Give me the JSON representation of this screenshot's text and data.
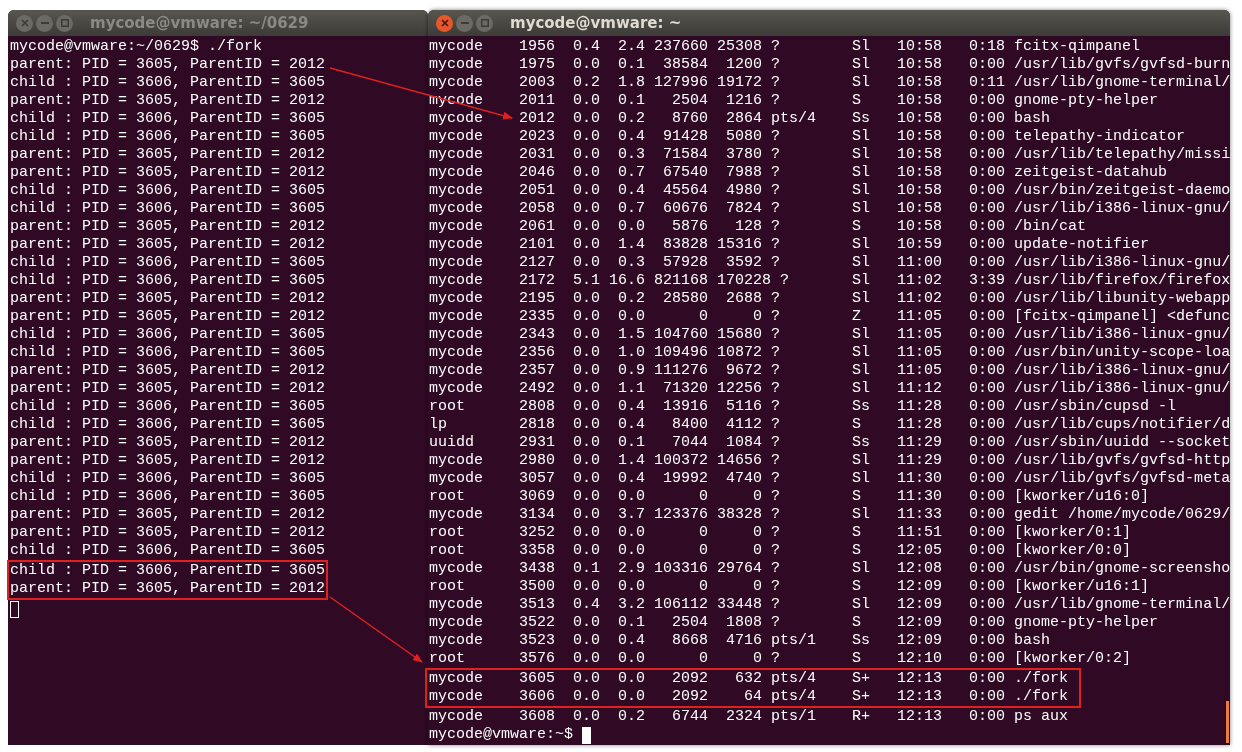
{
  "left_window": {
    "title": "mycode@vmware: ~/0629",
    "active": false,
    "prompt_line": "mycode@vmware:~/0629$ ./fork",
    "lines": [
      {
        "text": "parent: PID = 3605, ParentID = 2012",
        "highlighted": false
      },
      {
        "text": "child : PID = 3606, ParentID = 3605",
        "highlighted": false
      },
      {
        "text": "parent: PID = 3605, ParentID = 2012",
        "highlighted": false
      },
      {
        "text": "child : PID = 3606, ParentID = 3605",
        "highlighted": false
      },
      {
        "text": "child : PID = 3606, ParentID = 3605",
        "highlighted": false
      },
      {
        "text": "parent: PID = 3605, ParentID = 2012",
        "highlighted": false
      },
      {
        "text": "parent: PID = 3605, ParentID = 2012",
        "highlighted": false
      },
      {
        "text": "child : PID = 3606, ParentID = 3605",
        "highlighted": false
      },
      {
        "text": "child : PID = 3606, ParentID = 3605",
        "highlighted": false
      },
      {
        "text": "parent: PID = 3605, ParentID = 2012",
        "highlighted": false
      },
      {
        "text": "parent: PID = 3605, ParentID = 2012",
        "highlighted": false
      },
      {
        "text": "child : PID = 3606, ParentID = 3605",
        "highlighted": false
      },
      {
        "text": "child : PID = 3606, ParentID = 3605",
        "highlighted": false
      },
      {
        "text": "parent: PID = 3605, ParentID = 2012",
        "highlighted": false
      },
      {
        "text": "parent: PID = 3605, ParentID = 2012",
        "highlighted": false
      },
      {
        "text": "child : PID = 3606, ParentID = 3605",
        "highlighted": false
      },
      {
        "text": "child : PID = 3606, ParentID = 3605",
        "highlighted": false
      },
      {
        "text": "parent: PID = 3605, ParentID = 2012",
        "highlighted": false
      },
      {
        "text": "parent: PID = 3605, ParentID = 2012",
        "highlighted": false
      },
      {
        "text": "child : PID = 3606, ParentID = 3605",
        "highlighted": false
      },
      {
        "text": "child : PID = 3606, ParentID = 3605",
        "highlighted": false
      },
      {
        "text": "parent: PID = 3605, ParentID = 2012",
        "highlighted": false
      },
      {
        "text": "parent: PID = 3605, ParentID = 2012",
        "highlighted": false
      },
      {
        "text": "child : PID = 3606, ParentID = 3605",
        "highlighted": false
      },
      {
        "text": "child : PID = 3606, ParentID = 3605",
        "highlighted": false
      },
      {
        "text": "parent: PID = 3605, ParentID = 2012",
        "highlighted": false
      },
      {
        "text": "parent: PID = 3605, ParentID = 2012",
        "highlighted": false
      },
      {
        "text": "child : PID = 3606, ParentID = 3605",
        "highlighted": false
      },
      {
        "text": "child : PID = 3606, ParentID = 3605",
        "highlighted": true
      },
      {
        "text": "parent: PID = 3605, ParentID = 2012",
        "highlighted": true
      }
    ]
  },
  "right_window": {
    "title": "mycode@vmware: ~",
    "active": true,
    "prompt": "mycode@vmware:~$",
    "processes": [
      {
        "user": "mycode",
        "pid": "1956",
        "cpu": "0.4",
        "mem": "2.4",
        "vsz": "237660",
        "rss": "25308",
        "tty": "?",
        "stat": "Sl",
        "start": "10:58",
        "time": "0:18",
        "command": "fcitx-qimpanel",
        "highlighted": false
      },
      {
        "user": "mycode",
        "pid": "1975",
        "cpu": "0.0",
        "mem": "0.1",
        "vsz": "38584",
        "rss": "1200",
        "tty": "?",
        "stat": "Sl",
        "start": "10:58",
        "time": "0:00",
        "command": "/usr/lib/gvfs/gvfsd-burn",
        "highlighted": false
      },
      {
        "user": "mycode",
        "pid": "2003",
        "cpu": "0.2",
        "mem": "1.8",
        "vsz": "127996",
        "rss": "19172",
        "tty": "?",
        "stat": "Sl",
        "start": "10:58",
        "time": "0:11",
        "command": "/usr/lib/gnome-terminal/",
        "highlighted": false
      },
      {
        "user": "mycode",
        "pid": "2011",
        "cpu": "0.0",
        "mem": "0.1",
        "vsz": "2504",
        "rss": "1216",
        "tty": "?",
        "stat": "S",
        "start": "10:58",
        "time": "0:00",
        "command": "gnome-pty-helper",
        "highlighted": false
      },
      {
        "user": "mycode",
        "pid": "2012",
        "cpu": "0.0",
        "mem": "0.2",
        "vsz": "8760",
        "rss": "2864",
        "tty": "pts/4",
        "stat": "Ss",
        "start": "10:58",
        "time": "0:00",
        "command": "bash",
        "highlighted": false
      },
      {
        "user": "mycode",
        "pid": "2023",
        "cpu": "0.0",
        "mem": "0.4",
        "vsz": "91428",
        "rss": "5080",
        "tty": "?",
        "stat": "Sl",
        "start": "10:58",
        "time": "0:00",
        "command": "telepathy-indicator",
        "highlighted": false
      },
      {
        "user": "mycode",
        "pid": "2031",
        "cpu": "0.0",
        "mem": "0.3",
        "vsz": "71584",
        "rss": "3780",
        "tty": "?",
        "stat": "Sl",
        "start": "10:58",
        "time": "0:00",
        "command": "/usr/lib/telepathy/missi",
        "highlighted": false
      },
      {
        "user": "mycode",
        "pid": "2046",
        "cpu": "0.0",
        "mem": "0.7",
        "vsz": "67540",
        "rss": "7988",
        "tty": "?",
        "stat": "Sl",
        "start": "10:58",
        "time": "0:00",
        "command": "zeitgeist-datahub",
        "highlighted": false
      },
      {
        "user": "mycode",
        "pid": "2051",
        "cpu": "0.0",
        "mem": "0.4",
        "vsz": "45564",
        "rss": "4980",
        "tty": "?",
        "stat": "Sl",
        "start": "10:58",
        "time": "0:00",
        "command": "/usr/bin/zeitgeist-daemo",
        "highlighted": false
      },
      {
        "user": "mycode",
        "pid": "2058",
        "cpu": "0.0",
        "mem": "0.7",
        "vsz": "60676",
        "rss": "7824",
        "tty": "?",
        "stat": "Sl",
        "start": "10:58",
        "time": "0:00",
        "command": "/usr/lib/i386-linux-gnu/",
        "highlighted": false
      },
      {
        "user": "mycode",
        "pid": "2061",
        "cpu": "0.0",
        "mem": "0.0",
        "vsz": "5876",
        "rss": "128",
        "tty": "?",
        "stat": "S",
        "start": "10:58",
        "time": "0:00",
        "command": "/bin/cat",
        "highlighted": false
      },
      {
        "user": "mycode",
        "pid": "2101",
        "cpu": "0.0",
        "mem": "1.4",
        "vsz": "83828",
        "rss": "15316",
        "tty": "?",
        "stat": "Sl",
        "start": "10:59",
        "time": "0:00",
        "command": "update-notifier",
        "highlighted": false
      },
      {
        "user": "mycode",
        "pid": "2127",
        "cpu": "0.0",
        "mem": "0.3",
        "vsz": "57928",
        "rss": "3592",
        "tty": "?",
        "stat": "Sl",
        "start": "11:00",
        "time": "0:00",
        "command": "/usr/lib/i386-linux-gnu/",
        "highlighted": false
      },
      {
        "user": "mycode",
        "pid": "2172",
        "cpu": "5.1",
        "mem": "16.6",
        "vsz": "821168",
        "rss": "170228",
        "tty": "?",
        "stat": "Sl",
        "start": "11:02",
        "time": "3:39",
        "command": "/usr/lib/firefox/firefox",
        "highlighted": false
      },
      {
        "user": "mycode",
        "pid": "2195",
        "cpu": "0.0",
        "mem": "0.2",
        "vsz": "28580",
        "rss": "2688",
        "tty": "?",
        "stat": "Sl",
        "start": "11:02",
        "time": "0:00",
        "command": "/usr/lib/libunity-webapp",
        "highlighted": false
      },
      {
        "user": "mycode",
        "pid": "2335",
        "cpu": "0.0",
        "mem": "0.0",
        "vsz": "0",
        "rss": "0",
        "tty": "?",
        "stat": "Z",
        "start": "11:05",
        "time": "0:00",
        "command": "[fcitx-qimpanel] <defunc",
        "highlighted": false
      },
      {
        "user": "mycode",
        "pid": "2343",
        "cpu": "0.0",
        "mem": "1.5",
        "vsz": "104760",
        "rss": "15680",
        "tty": "?",
        "stat": "Sl",
        "start": "11:05",
        "time": "0:00",
        "command": "/usr/lib/i386-linux-gnu/",
        "highlighted": false
      },
      {
        "user": "mycode",
        "pid": "2356",
        "cpu": "0.0",
        "mem": "1.0",
        "vsz": "109496",
        "rss": "10872",
        "tty": "?",
        "stat": "Sl",
        "start": "11:05",
        "time": "0:00",
        "command": "/usr/bin/unity-scope-loa",
        "highlighted": false
      },
      {
        "user": "mycode",
        "pid": "2357",
        "cpu": "0.0",
        "mem": "0.9",
        "vsz": "111276",
        "rss": "9672",
        "tty": "?",
        "stat": "Sl",
        "start": "11:05",
        "time": "0:00",
        "command": "/usr/lib/i386-linux-gnu/",
        "highlighted": false
      },
      {
        "user": "mycode",
        "pid": "2492",
        "cpu": "0.0",
        "mem": "1.1",
        "vsz": "71320",
        "rss": "12256",
        "tty": "?",
        "stat": "Sl",
        "start": "11:12",
        "time": "0:00",
        "command": "/usr/lib/i386-linux-gnu/",
        "highlighted": false
      },
      {
        "user": "root",
        "pid": "2808",
        "cpu": "0.0",
        "mem": "0.4",
        "vsz": "13916",
        "rss": "5116",
        "tty": "?",
        "stat": "Ss",
        "start": "11:28",
        "time": "0:00",
        "command": "/usr/sbin/cupsd -l",
        "highlighted": false
      },
      {
        "user": "lp",
        "pid": "2818",
        "cpu": "0.0",
        "mem": "0.4",
        "vsz": "8400",
        "rss": "4112",
        "tty": "?",
        "stat": "S",
        "start": "11:28",
        "time": "0:00",
        "command": "/usr/lib/cups/notifier/d",
        "highlighted": false
      },
      {
        "user": "uuidd",
        "pid": "2931",
        "cpu": "0.0",
        "mem": "0.1",
        "vsz": "7044",
        "rss": "1084",
        "tty": "?",
        "stat": "Ss",
        "start": "11:29",
        "time": "0:00",
        "command": "/usr/sbin/uuidd --socket",
        "highlighted": false
      },
      {
        "user": "mycode",
        "pid": "2980",
        "cpu": "0.0",
        "mem": "1.4",
        "vsz": "100372",
        "rss": "14656",
        "tty": "?",
        "stat": "Sl",
        "start": "11:29",
        "time": "0:00",
        "command": "/usr/lib/gvfs/gvfsd-http",
        "highlighted": false
      },
      {
        "user": "mycode",
        "pid": "3057",
        "cpu": "0.0",
        "mem": "0.4",
        "vsz": "19992",
        "rss": "4740",
        "tty": "?",
        "stat": "Sl",
        "start": "11:30",
        "time": "0:00",
        "command": "/usr/lib/gvfs/gvfsd-meta",
        "highlighted": false
      },
      {
        "user": "root",
        "pid": "3069",
        "cpu": "0.0",
        "mem": "0.0",
        "vsz": "0",
        "rss": "0",
        "tty": "?",
        "stat": "S",
        "start": "11:30",
        "time": "0:00",
        "command": "[kworker/u16:0]",
        "highlighted": false
      },
      {
        "user": "mycode",
        "pid": "3134",
        "cpu": "0.0",
        "mem": "3.7",
        "vsz": "123376",
        "rss": "38328",
        "tty": "?",
        "stat": "Sl",
        "start": "11:33",
        "time": "0:00",
        "command": "gedit /home/mycode/0629/",
        "highlighted": false
      },
      {
        "user": "root",
        "pid": "3252",
        "cpu": "0.0",
        "mem": "0.0",
        "vsz": "0",
        "rss": "0",
        "tty": "?",
        "stat": "S",
        "start": "11:51",
        "time": "0:00",
        "command": "[kworker/0:1]",
        "highlighted": false
      },
      {
        "user": "root",
        "pid": "3358",
        "cpu": "0.0",
        "mem": "0.0",
        "vsz": "0",
        "rss": "0",
        "tty": "?",
        "stat": "S",
        "start": "12:05",
        "time": "0:00",
        "command": "[kworker/0:0]",
        "highlighted": false
      },
      {
        "user": "mycode",
        "pid": "3438",
        "cpu": "0.1",
        "mem": "2.9",
        "vsz": "103316",
        "rss": "29764",
        "tty": "?",
        "stat": "Sl",
        "start": "12:08",
        "time": "0:00",
        "command": "/usr/bin/gnome-screensho",
        "highlighted": false
      },
      {
        "user": "root",
        "pid": "3500",
        "cpu": "0.0",
        "mem": "0.0",
        "vsz": "0",
        "rss": "0",
        "tty": "?",
        "stat": "S",
        "start": "12:09",
        "time": "0:00",
        "command": "[kworker/u16:1]",
        "highlighted": false
      },
      {
        "user": "mycode",
        "pid": "3513",
        "cpu": "0.4",
        "mem": "3.2",
        "vsz": "106112",
        "rss": "33448",
        "tty": "?",
        "stat": "Sl",
        "start": "12:09",
        "time": "0:00",
        "command": "/usr/lib/gnome-terminal/",
        "highlighted": false
      },
      {
        "user": "mycode",
        "pid": "3522",
        "cpu": "0.0",
        "mem": "0.1",
        "vsz": "2504",
        "rss": "1808",
        "tty": "?",
        "stat": "S",
        "start": "12:09",
        "time": "0:00",
        "command": "gnome-pty-helper",
        "highlighted": false
      },
      {
        "user": "mycode",
        "pid": "3523",
        "cpu": "0.0",
        "mem": "0.4",
        "vsz": "8668",
        "rss": "4716",
        "tty": "pts/1",
        "stat": "Ss",
        "start": "12:09",
        "time": "0:00",
        "command": "bash",
        "highlighted": false
      },
      {
        "user": "root",
        "pid": "3576",
        "cpu": "0.0",
        "mem": "0.0",
        "vsz": "0",
        "rss": "0",
        "tty": "?",
        "stat": "S",
        "start": "12:10",
        "time": "0:00",
        "command": "[kworker/0:2]",
        "highlighted": false
      },
      {
        "user": "mycode",
        "pid": "3605",
        "cpu": "0.0",
        "mem": "0.0",
        "vsz": "2092",
        "rss": "632",
        "tty": "pts/4",
        "stat": "S+",
        "start": "12:13",
        "time": "0:00",
        "command": "./fork",
        "highlighted": true
      },
      {
        "user": "mycode",
        "pid": "3606",
        "cpu": "0.0",
        "mem": "0.0",
        "vsz": "2092",
        "rss": "64",
        "tty": "pts/4",
        "stat": "S+",
        "start": "12:13",
        "time": "0:00",
        "command": "./fork",
        "highlighted": true
      },
      {
        "user": "mycode",
        "pid": "3608",
        "cpu": "0.0",
        "mem": "0.2",
        "vsz": "6744",
        "rss": "2324",
        "tty": "pts/1",
        "stat": "R+",
        "start": "12:13",
        "time": "0:00",
        "command": "ps aux",
        "highlighted": false
      }
    ]
  }
}
